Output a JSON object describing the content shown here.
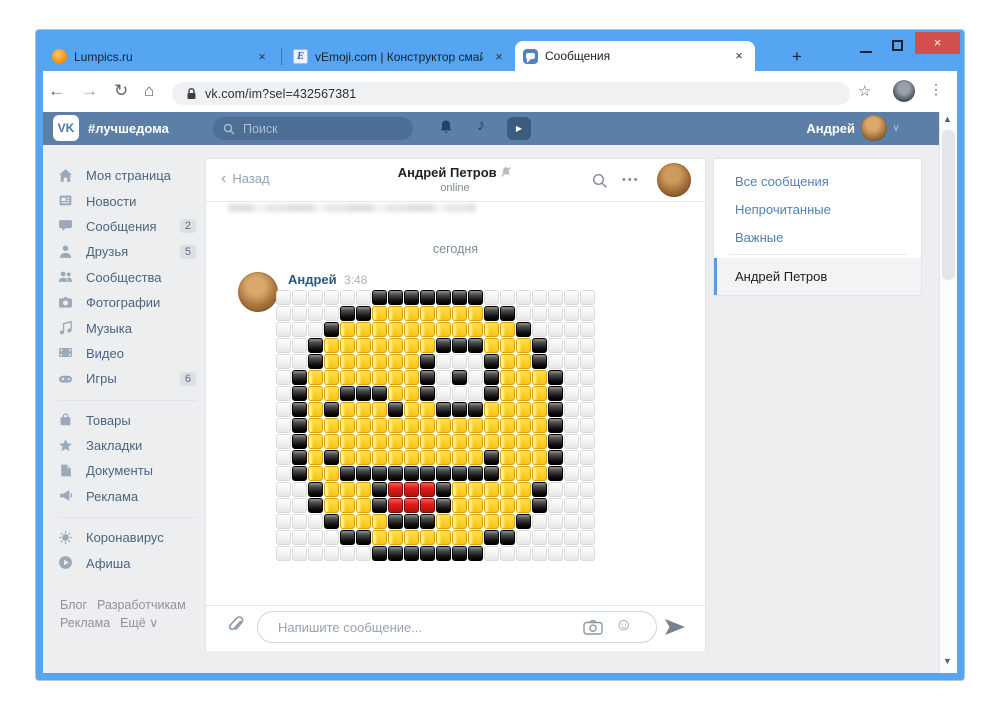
{
  "browser": {
    "tabs": [
      {
        "key": "lumpics",
        "label": "Lumpics.ru",
        "favicon": "lumpics-favicon",
        "active": false
      },
      {
        "key": "vemoji",
        "label": "vEmoji.com | Конструктор смайл",
        "favicon": "vemoji-favicon",
        "active": false
      },
      {
        "key": "messages",
        "label": "Сообщения",
        "favicon": "vk-messenger-favicon",
        "active": true
      }
    ],
    "new_tab_label": "+",
    "url": "vk.com/im?sel=432567381"
  },
  "vk": {
    "header": {
      "logo_text": "VK",
      "hashtag": "#лучшедома",
      "search_placeholder": "Поиск",
      "user_name": "Андрей"
    },
    "sidebar": {
      "items": [
        {
          "key": "my-page",
          "label": "Моя страница",
          "icon": "home-icon",
          "badge": ""
        },
        {
          "key": "news",
          "label": "Новости",
          "icon": "news-icon",
          "badge": ""
        },
        {
          "key": "messages",
          "label": "Сообщения",
          "icon": "messages-icon",
          "badge": "2"
        },
        {
          "key": "friends",
          "label": "Друзья",
          "icon": "friends-icon",
          "badge": "5"
        },
        {
          "key": "communities",
          "label": "Сообщества",
          "icon": "communities-icon",
          "badge": ""
        },
        {
          "key": "photos",
          "label": "Фотографии",
          "icon": "photos-icon",
          "badge": ""
        },
        {
          "key": "music",
          "label": "Музыка",
          "icon": "music-icon",
          "badge": ""
        },
        {
          "key": "video",
          "label": "Видео",
          "icon": "video-icon",
          "badge": ""
        },
        {
          "key": "games",
          "label": "Игры",
          "icon": "games-icon",
          "badge": "6"
        },
        {
          "key": "market",
          "label": "Товары",
          "icon": "market-icon",
          "badge": ""
        },
        {
          "key": "bookmarks",
          "label": "Закладки",
          "icon": "bookmarks-icon",
          "badge": ""
        },
        {
          "key": "documents",
          "label": "Документы",
          "icon": "documents-icon",
          "badge": ""
        },
        {
          "key": "ads",
          "label": "Реклама",
          "icon": "ads-icon",
          "badge": ""
        },
        {
          "key": "coronavirus",
          "label": "Коронавирус",
          "icon": "virus-icon",
          "badge": ""
        },
        {
          "key": "events",
          "label": "Афиша",
          "icon": "events-icon",
          "badge": ""
        }
      ],
      "footer_line1": [
        "Блог",
        "Разработчикам"
      ],
      "footer_line2": [
        "Реклама",
        "Ещё"
      ]
    },
    "chat": {
      "back_label": "Назад",
      "peer_name": "Андрей Петров",
      "peer_status": "online",
      "date_divider": "сегодня",
      "message": {
        "author": "Андрей",
        "time": "3:48"
      },
      "composer_placeholder": "Напишите сообщение..."
    },
    "dialogs_panel": {
      "filters": [
        "Все сообщения",
        "Непрочитанные",
        "Важные"
      ],
      "selected": "Андрей Петров"
    }
  },
  "emoji_grid": {
    "legend": {
      "W": "white-square",
      "B": "black-square",
      "Y": "yellow-square",
      "R": "red-square"
    },
    "palette": {
      "W": "#f2f2f2",
      "B": "#111111",
      "Y": "#f9cb1d",
      "R": "#d81f1c"
    },
    "rows": [
      "WWWWWWBBBBBBBWWWWWWW",
      "WWWWBBYYYYYYYBBWWWWW",
      "WWWBYYYYYYYYYYYBWWWW",
      "WWBYYYYYYYBBBYYYBWWW",
      "WWBYYYYYYBWWWBYYBWWW",
      "WBYYYYYYYBWBWBYYYBWW",
      "WBYYBBBYYBWWWBYYYBWW",
      "WBYBYYYBYYBBBYYYYBWW",
      "WBYYYYYYYYYYYYYYYBWW",
      "WBYYYYYYYYYYYYYYYBWW",
      "WBYBYYYYYYYYYBYYYBWW",
      "WBYYBBBBBBBBBBYYYBWW",
      "WWBYYYBRRRBYYYYYBWWW",
      "WWBYYYBRRRBYYYYYBWWW",
      "WWWBYYYBBBYYYYYBWWWW",
      "WWWWBBYYYYYYYBBWWWWW",
      "WWWWWWBBBBBBBWWWWWWW"
    ]
  },
  "icons": {
    "close": "×",
    "star": "☆",
    "menu_dots": "⋮",
    "more_dots": "•••",
    "back_chevron": "‹",
    "chevron_down": "∨",
    "music_note": "♪",
    "smiley": "☺",
    "home": "⌂",
    "back_arrow": "←",
    "forward_arrow": "→",
    "reload": "↻",
    "play": "▶",
    "scroll_up": "▲",
    "scroll_down": "▼"
  },
  "colors": {
    "window_frame": "#55a5f3",
    "close_button": "#d1504b",
    "vk_header": "#5b7fa6",
    "page_bg": "#edeef0",
    "link_blue": "#5181b8",
    "selected_bar": "#5c9ce6"
  }
}
